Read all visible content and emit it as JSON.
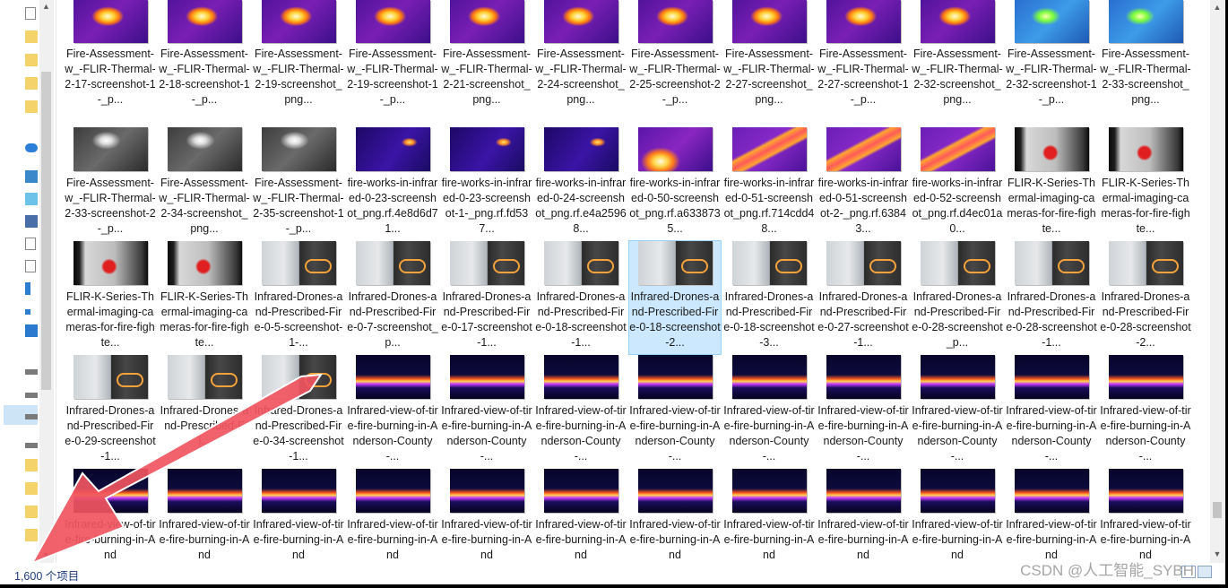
{
  "status": {
    "item_count": "1,600 个项目"
  },
  "watermark": "CSDN @人工智能_SYBH",
  "colors": {
    "arrow": "#f0555f",
    "selection": "#cce8ff"
  },
  "rows": [
    [
      {
        "thumb": "fire",
        "name": "Fire-Assessment-w_-FLIR-Thermal-2-17-screenshot-1-_p..."
      },
      {
        "thumb": "fire",
        "name": "Fire-Assessment-w_-FLIR-Thermal-2-18-screenshot-1-_p..."
      },
      {
        "thumb": "fire",
        "name": "Fire-Assessment-w_-FLIR-Thermal-2-19-screenshot_png..."
      },
      {
        "thumb": "fire",
        "name": "Fire-Assessment-w_-FLIR-Thermal-2-19-screenshot-1-_p..."
      },
      {
        "thumb": "fire",
        "name": "Fire-Assessment-w_-FLIR-Thermal-2-21-screenshot_png..."
      },
      {
        "thumb": "fire",
        "name": "Fire-Assessment-w_-FLIR-Thermal-2-24-screenshot_png..."
      },
      {
        "thumb": "fire",
        "name": "Fire-Assessment-w_-FLIR-Thermal-2-25-screenshot-2-_p..."
      },
      {
        "thumb": "fire",
        "name": "Fire-Assessment-w_-FLIR-Thermal-2-27-screenshot_png..."
      },
      {
        "thumb": "fire",
        "name": "Fire-Assessment-w_-FLIR-Thermal-2-27-screenshot-1-_p..."
      },
      {
        "thumb": "fire",
        "name": "Fire-Assessment-w_-FLIR-Thermal-2-32-screenshot_png..."
      },
      {
        "thumb": "blue",
        "name": "Fire-Assessment-w_-FLIR-Thermal-2-32-screenshot-1-_p..."
      },
      {
        "thumb": "blue",
        "name": "Fire-Assessment-w_-FLIR-Thermal-2-33-screenshot_png..."
      }
    ],
    [
      {
        "thumb": "gray",
        "name": "Fire-Assessment-w_-FLIR-Thermal-2-33-screenshot-2-_p..."
      },
      {
        "thumb": "gray",
        "name": "Fire-Assessment-w_-FLIR-Thermal-2-34-screenshot_png..."
      },
      {
        "thumb": "gray",
        "name": "Fire-Assessment-w_-FLIR-Thermal-2-35-screenshot-1-_p..."
      },
      {
        "thumb": "works",
        "name": "fire-works-in-infrared-0-23-screenshot_png.rf.4e8d6d71..."
      },
      {
        "thumb": "works",
        "name": "fire-works-in-infrared-0-23-screenshot-1-_png.rf.fd537..."
      },
      {
        "thumb": "works",
        "name": "fire-works-in-infrared-0-24-screenshot_png.rf.e4a25968..."
      },
      {
        "thumb": "works2",
        "name": "fire-works-in-infrared-0-50-screenshot_png.rf.a6338735..."
      },
      {
        "thumb": "band",
        "name": "fire-works-in-infrared-0-51-screenshot_png.rf.714cdd48..."
      },
      {
        "thumb": "band",
        "name": "fire-works-in-infrared-0-51-screenshot-2-_png.rf.63843..."
      },
      {
        "thumb": "band",
        "name": "fire-works-in-infrared-0-52-screenshot_png.rf.d4ec01a0..."
      },
      {
        "thumb": "kflir",
        "name": "FLIR-K-Series-Thermal-imaging-cameras-for-fire-fighte..."
      },
      {
        "thumb": "kflir",
        "name": "FLIR-K-Series-Thermal-imaging-cameras-for-fire-fighte..."
      }
    ],
    [
      {
        "thumb": "kflir",
        "name": "FLIR-K-Series-Thermal-imaging-cameras-for-fire-fighte..."
      },
      {
        "thumb": "kflir",
        "name": "FLIR-K-Series-Thermal-imaging-cameras-for-fire-fighte..."
      },
      {
        "thumb": "split",
        "name": "Infrared-Drones-and-Prescribed-Fire-0-5-screenshot-1-..."
      },
      {
        "thumb": "split",
        "name": "Infrared-Drones-and-Prescribed-Fire-0-7-screenshot_p..."
      },
      {
        "thumb": "split",
        "name": "Infrared-Drones-and-Prescribed-Fire-0-17-screenshot-1..."
      },
      {
        "thumb": "split",
        "name": "Infrared-Drones-and-Prescribed-Fire-0-18-screenshot-1..."
      },
      {
        "thumb": "split",
        "name": "Infrared-Drones-and-Prescribed-Fire-0-18-screenshot-2...",
        "selected": true
      },
      {
        "thumb": "split",
        "name": "Infrared-Drones-and-Prescribed-Fire-0-18-screenshot-3..."
      },
      {
        "thumb": "split",
        "name": "Infrared-Drones-and-Prescribed-Fire-0-27-screenshot-1..."
      },
      {
        "thumb": "split",
        "name": "Infrared-Drones-and-Prescribed-Fire-0-28-screenshot_p..."
      },
      {
        "thumb": "split",
        "name": "Infrared-Drones-and-Prescribed-Fire-0-28-screenshot-1..."
      },
      {
        "thumb": "split",
        "name": "Infrared-Drones-and-Prescribed-Fire-0-28-screenshot-2..."
      }
    ],
    [
      {
        "thumb": "split",
        "name": "Infrared-Drones-and-Prescribed-Fire-0-29-screenshot-1..."
      },
      {
        "thumb": "split",
        "name": "Infrared-Drones-and-Prescribed-Fi..."
      },
      {
        "thumb": "split",
        "name": "Infrared-Drones-and-Prescribed-Fire-0-34-screenshot-1..."
      },
      {
        "thumb": "tire",
        "name": "Infrared-view-of-tire-fire-burning-in-Anderson-County-..."
      },
      {
        "thumb": "tire",
        "name": "Infrared-view-of-tire-fire-burning-in-Anderson-County-..."
      },
      {
        "thumb": "tire",
        "name": "Infrared-view-of-tire-fire-burning-in-Anderson-County-..."
      },
      {
        "thumb": "tire",
        "name": "Infrared-view-of-tire-fire-burning-in-Anderson-County-..."
      },
      {
        "thumb": "tire",
        "name": "Infrared-view-of-tire-fire-burning-in-Anderson-County-..."
      },
      {
        "thumb": "tire",
        "name": "Infrared-view-of-tire-fire-burning-in-Anderson-County-..."
      },
      {
        "thumb": "tire",
        "name": "Infrared-view-of-tire-fire-burning-in-Anderson-County-..."
      },
      {
        "thumb": "tire",
        "name": "Infrared-view-of-tire-fire-burning-in-Anderson-County-..."
      },
      {
        "thumb": "tire",
        "name": "Infrared-view-of-tire-fire-burning-in-Anderson-County-..."
      }
    ],
    [
      {
        "thumb": "tire",
        "name": "Infrared-view-of-tire-fire-burning-in-And"
      },
      {
        "thumb": "tire",
        "name": "Infrared-view-of-tire-fire-burning-in-And"
      },
      {
        "thumb": "tire",
        "name": "Infrared-view-of-tire-fire-burning-in-And"
      },
      {
        "thumb": "tire",
        "name": "Infrared-view-of-tire-fire-burning-in-And"
      },
      {
        "thumb": "tire",
        "name": "Infrared-view-of-tire-fire-burning-in-And"
      },
      {
        "thumb": "tire",
        "name": "Infrared-view-of-tire-fire-burning-in-And"
      },
      {
        "thumb": "tire",
        "name": "Infrared-view-of-tire-fire-burning-in-And"
      },
      {
        "thumb": "tire",
        "name": "Infrared-view-of-tire-fire-burning-in-And"
      },
      {
        "thumb": "tire",
        "name": "Infrared-view-of-tire-fire-burning-in-And"
      },
      {
        "thumb": "tire",
        "name": "Infrared-view-of-tire-fire-burning-in-And"
      },
      {
        "thumb": "tire",
        "name": "Infrared-view-of-tire-fire-burning-in-And"
      },
      {
        "thumb": "tire",
        "name": "Infrared-view-of-tire-fire-burning-in-And"
      }
    ]
  ]
}
